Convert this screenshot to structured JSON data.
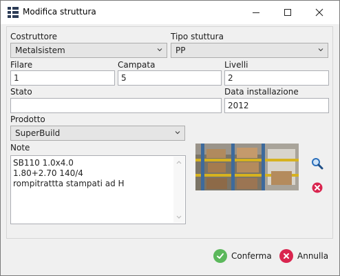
{
  "window": {
    "title": "Modifica struttura"
  },
  "form": {
    "costruttore": {
      "label": "Costruttore",
      "value": "Metalsistem"
    },
    "tipo_struttura": {
      "label": "Tipo stuttura",
      "value": "PP"
    },
    "filare": {
      "label": "Filare",
      "value": "1"
    },
    "campata": {
      "label": "Campata",
      "value": "5"
    },
    "livelli": {
      "label": "Livelli",
      "value": "2"
    },
    "stato": {
      "label": "Stato",
      "value": ""
    },
    "data_installazione": {
      "label": "Data installazione",
      "value": "2012"
    },
    "prodotto": {
      "label": "Prodotto",
      "value": "SuperBuild"
    },
    "note": {
      "label": "Note",
      "lines": [
        "SB110 1.0x4.0",
        "1.80+2.70 140/4",
        "rompitrattta stampati ad H"
      ]
    }
  },
  "icons": {
    "zoom": "magnifier-icon",
    "delete_image": "remove-icon",
    "confirm": "check-circle-icon",
    "cancel": "x-circle-icon"
  },
  "colors": {
    "confirm": "#5cb85c",
    "cancel": "#d9254f",
    "zoom": "#2a6ebb"
  },
  "footer": {
    "confirm_label": "Conferma",
    "cancel_label": "Annulla"
  }
}
